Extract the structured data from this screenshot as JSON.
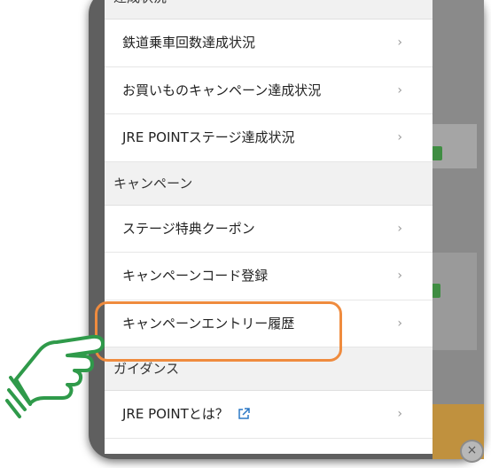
{
  "menu": {
    "top_section": "達成状況",
    "achievement_items": [
      {
        "label": "鉄道乗車回数達成状況"
      },
      {
        "label": "お買いものキャンペーン達成状況"
      },
      {
        "label": "JRE POINTステージ達成状況"
      }
    ],
    "campaign_section": "キャンペーン",
    "campaign_items": [
      {
        "label": "ステージ特典クーポン"
      },
      {
        "label": "キャンペーンコード登録"
      },
      {
        "label": "キャンペーンエントリー履歴"
      }
    ],
    "guidance_section": "ガイダンス",
    "guidance_items": [
      {
        "label": "JRE POINTとは？"
      }
    ],
    "chevron": "›"
  },
  "background": {
    "close_badge": "×"
  },
  "icons": {
    "pointing": "hand-pointing-icon",
    "external": "external-link-icon"
  },
  "colors": {
    "highlight": "#ef8b3e",
    "hand": "#2f9a4a"
  }
}
